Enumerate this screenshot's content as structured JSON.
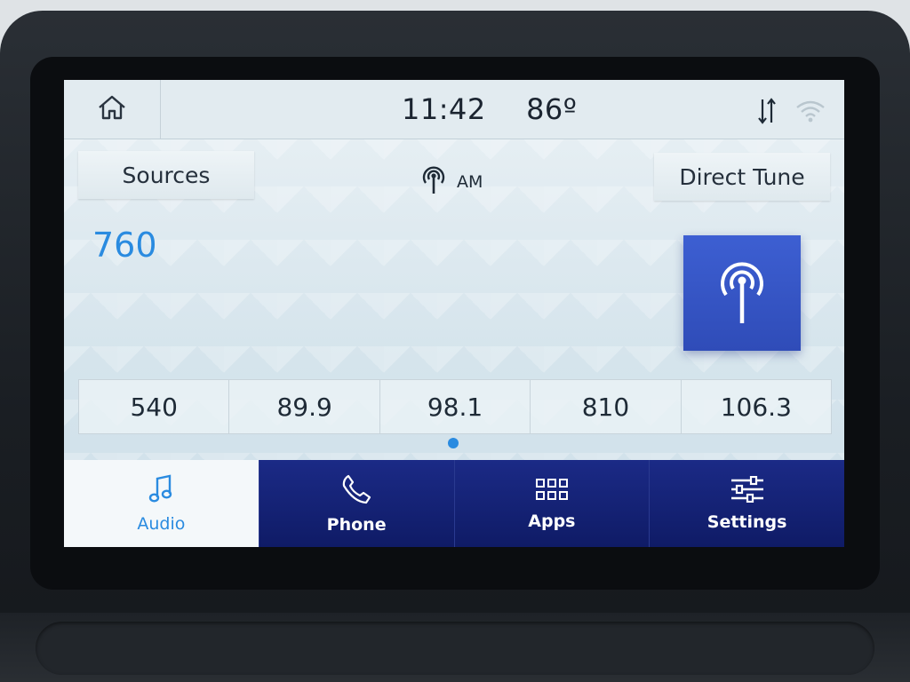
{
  "status": {
    "time": "11:42",
    "temperature": "86º"
  },
  "header": {
    "sources_label": "Sources",
    "band_label": "AM",
    "direct_tune_label": "Direct Tune"
  },
  "now_playing": {
    "frequency": "760"
  },
  "presets": [
    "540",
    "89.9",
    "98.1",
    "810",
    "106.3"
  ],
  "nav": {
    "audio": "Audio",
    "phone": "Phone",
    "apps": "Apps",
    "settings": "Settings"
  },
  "colors": {
    "accent": "#2a8be0",
    "nav_bg": "#142174",
    "tile_bg": "#3d5fd2"
  },
  "icons": {
    "home": "home-icon",
    "data_transfer": "data-transfer-icon",
    "wifi": "wifi-icon",
    "antenna": "antenna-icon",
    "music": "music-note-icon",
    "phone": "phone-icon",
    "apps": "apps-grid-icon",
    "settings": "sliders-icon"
  }
}
